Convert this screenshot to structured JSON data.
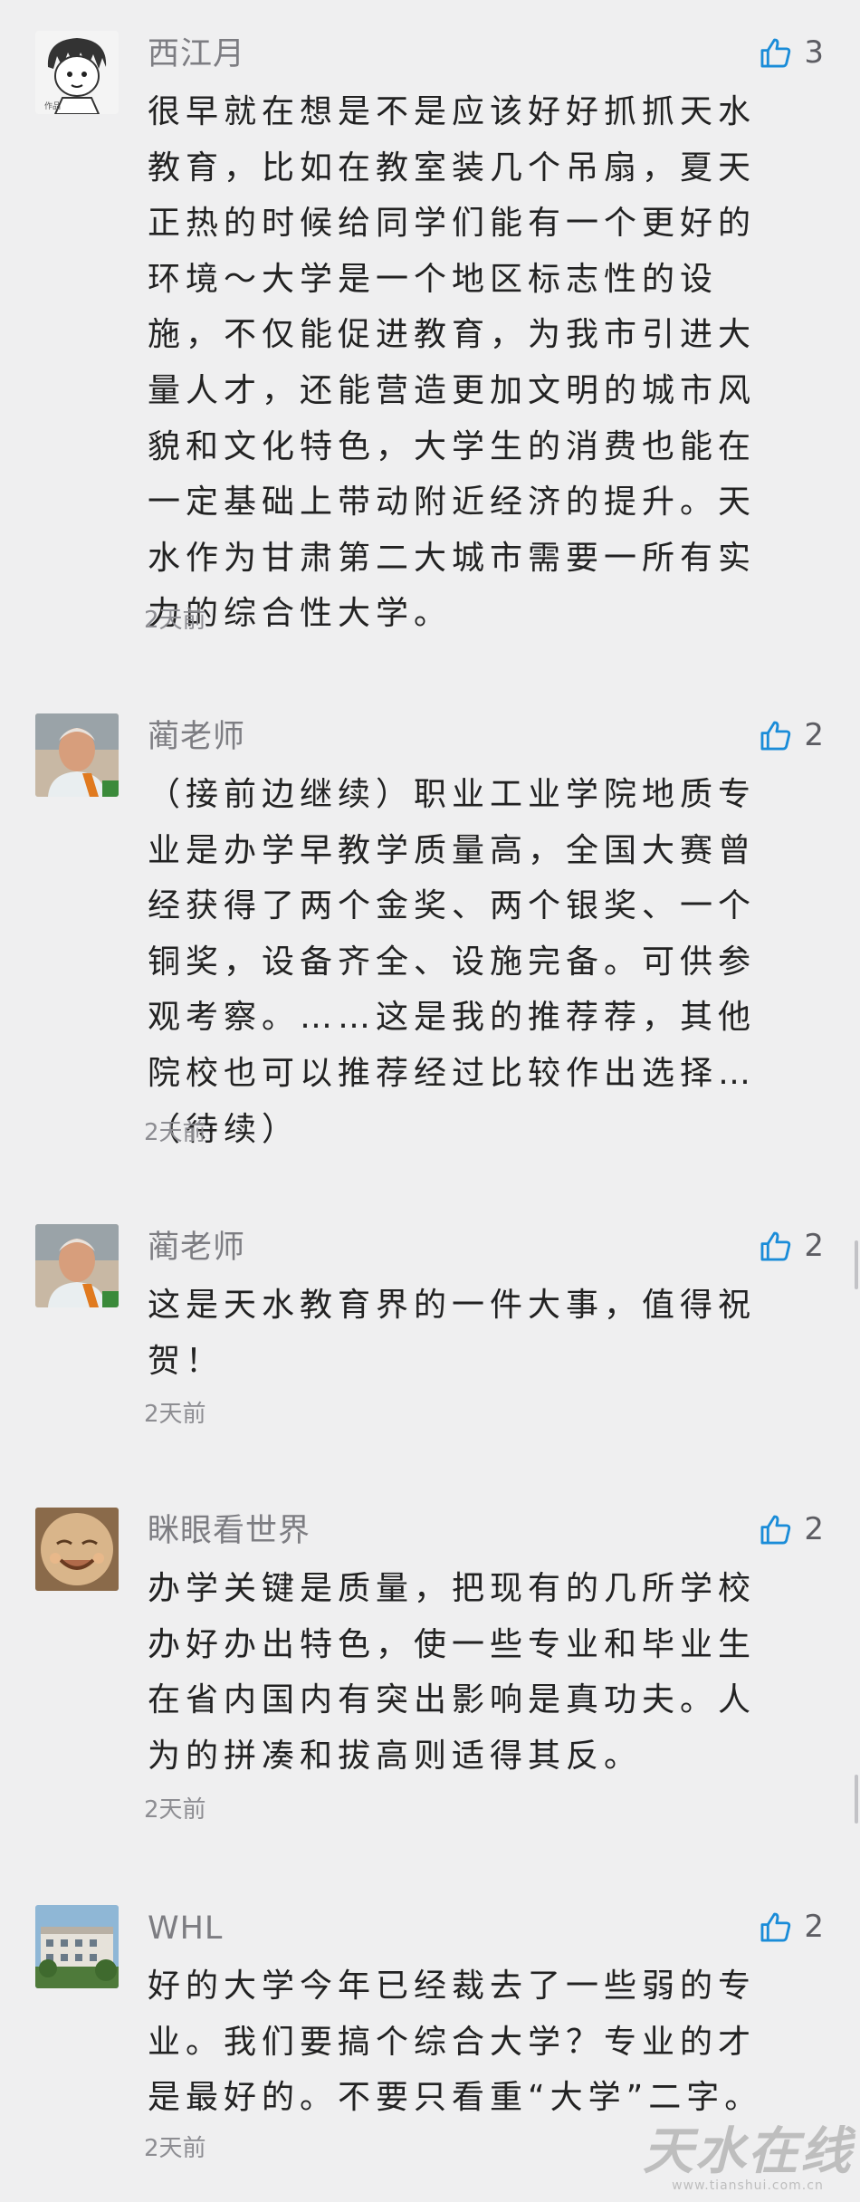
{
  "comments": [
    {
      "author": "西江月",
      "likes": "3",
      "text": "很早就在想是不是应该好好抓抓天水教育，比如在教室装几个吊扇，夏天正热的时候给同学们能有一个更好的环境～大学是一个地区标志性的设施，不仅能促进教育，为我市引进大量人才，还能营造更加文明的城市风貌和文化特色，大学生的消费也能在一定基础上带动附近经济的提升。天水作为甘肃第二大城市需要一所有实力的综合性大学。",
      "time": "2天前"
    },
    {
      "author": "蔺老师",
      "likes": "2",
      "text": "（接前边继续）职业工业学院地质专业是办学早教学质量高，全国大赛曾经获得了两个金奖、两个银奖、一个铜奖，设备齐全、设施完备。可供参观考察。……这是我的推荐荐，其他院校也可以推荐经过比较作出选择…（待续）",
      "time": "2天前"
    },
    {
      "author": "蔺老师",
      "likes": "2",
      "text": "这是天水教育界的一件大事，值得祝贺！",
      "time": "2天前"
    },
    {
      "author": "眯眼看世界",
      "likes": "2",
      "text": "办学关键是质量，把现有的几所学校办好办出特色，使一些专业和毕业生在省内国内有突出影响是真功夫。人为的拼凑和拔高则适得其反。",
      "time": "2天前"
    },
    {
      "author": "WHL",
      "likes": "2",
      "text": "好的大学今年已经裁去了一些弱的专业。我们要搞个综合大学？专业的才是最好的。不要只看重“大学”二字。",
      "time": "2天前"
    }
  ],
  "icons": {
    "like": "thumbs-up-icon"
  },
  "colors": {
    "background": "#efeff0",
    "author": "#7d7d82",
    "text": "#222222",
    "time": "#8d8d92",
    "like_icon": "#1a8cd8"
  },
  "watermark": {
    "logo_text": "天水在线",
    "url": "www.tianshui.com.cn"
  }
}
